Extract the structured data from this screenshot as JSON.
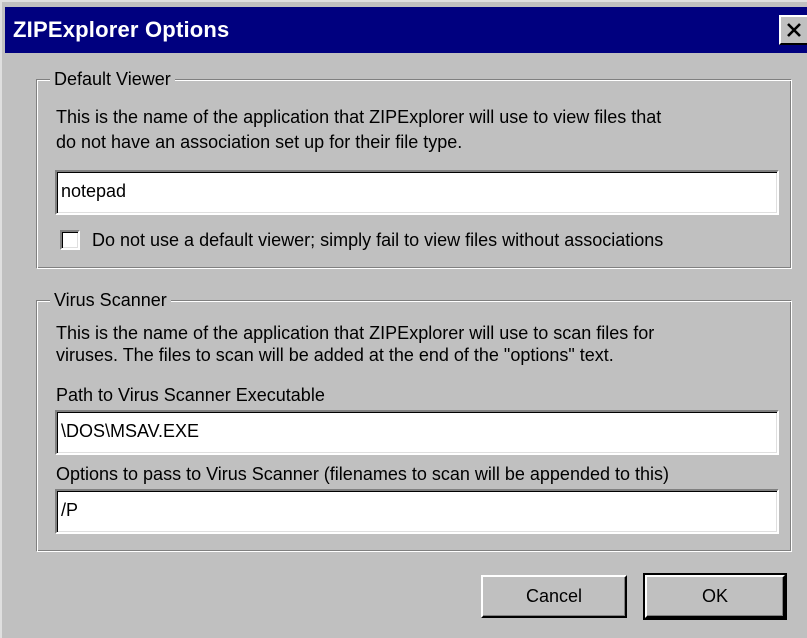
{
  "window": {
    "title": "ZIPExplorer Options",
    "close_icon": "close-icon"
  },
  "default_viewer": {
    "legend": "Default Viewer",
    "description_line1": "This is the name of the application that ZIPExplorer will use to view files that",
    "description_line2": "do not have an association set up for their file type.",
    "input_value": "notepad",
    "checkbox_checked": false,
    "checkbox_label": "Do not use a default viewer; simply fail to view files without associations"
  },
  "virus_scanner": {
    "legend": "Virus Scanner",
    "description_line1": "This is the name of the application that ZIPExplorer will use to scan files for",
    "description_line2": "viruses.  The files to scan will be added at the end of the \"options\" text.",
    "path_label": "Path to Virus Scanner Executable",
    "path_value": "\\DOS\\MSAV.EXE",
    "options_label": "Options to pass to Virus Scanner (filenames to scan will be appended to this)",
    "options_value": "/P"
  },
  "buttons": {
    "cancel_label": "Cancel",
    "ok_label": "OK"
  },
  "colors": {
    "titlebar": "#00007f",
    "face": "#c0c0c0"
  }
}
